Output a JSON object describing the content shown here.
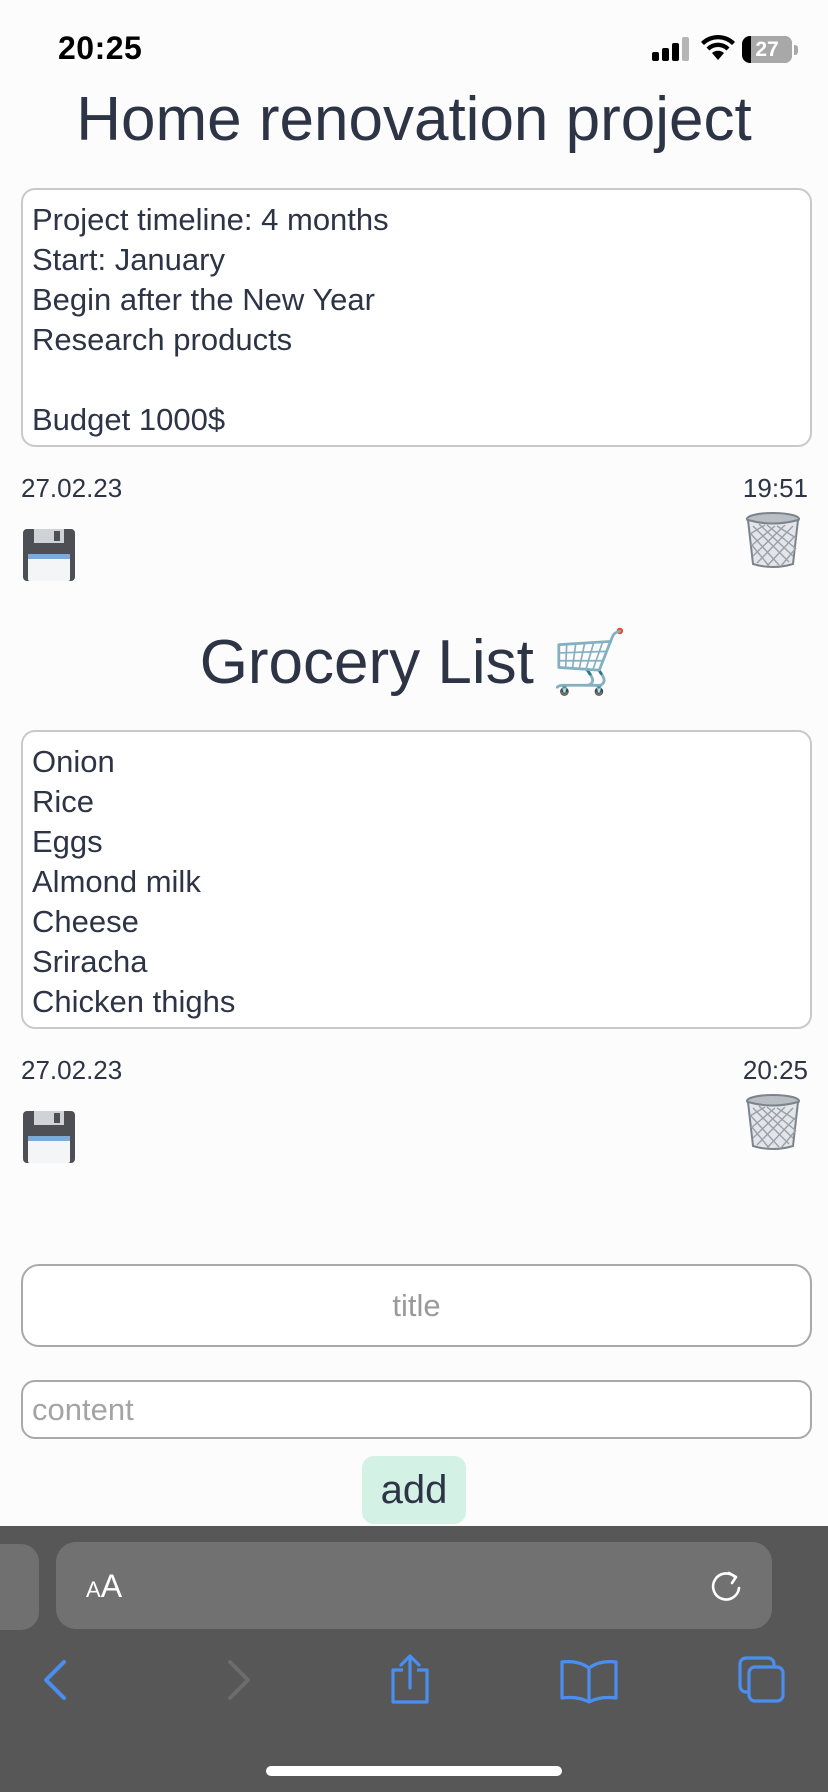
{
  "status_bar": {
    "time": "20:25",
    "battery": "27"
  },
  "notes": [
    {
      "title": "Home renovation project",
      "lines": [
        "Project timeline: 4 months",
        "Start: January",
        "Begin after the New Year",
        "Research products",
        "",
        "Budget 1000$"
      ],
      "date": "27.02.23",
      "time": "19:51",
      "save_icon": "floppy-disk-icon",
      "delete_icon": "wastebasket-icon"
    },
    {
      "title": "Grocery List 🛒",
      "lines": [
        "Onion",
        "Rice",
        "Eggs",
        "Almond milk",
        "Cheese",
        "Sriracha",
        "Chicken thighs"
      ],
      "date": "27.02.23",
      "time": "20:25",
      "save_icon": "floppy-disk-icon",
      "delete_icon": "wastebasket-icon"
    }
  ],
  "form": {
    "title_placeholder": "title",
    "content_placeholder": "content",
    "add_label": "add"
  },
  "browser": {
    "aa_small": "A",
    "aa_big": "A",
    "accent": "#3b82f6"
  }
}
